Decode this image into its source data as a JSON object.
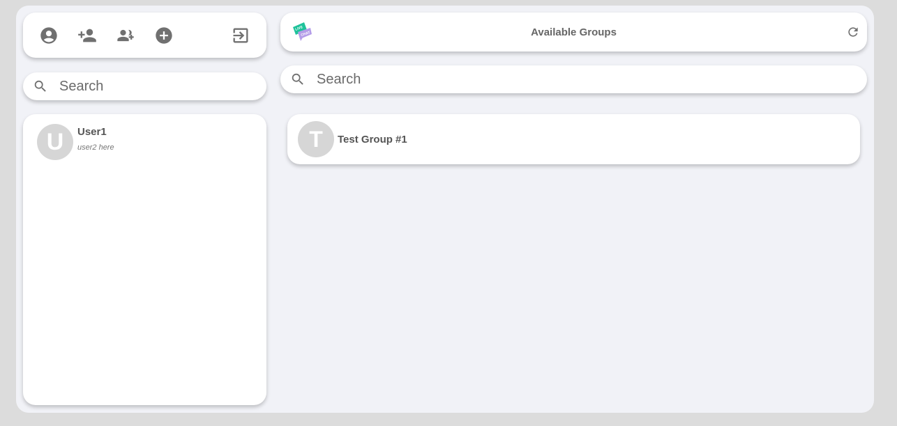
{
  "toolbar": {
    "icons": [
      "account-circle-icon",
      "person-add-icon",
      "group-add-icon",
      "add-circle-icon",
      "dark-mode-moon-icon",
      "logout-icon"
    ]
  },
  "left_search": {
    "placeholder": "Search"
  },
  "users": [
    {
      "initial": "U",
      "name": "User1",
      "status": "user2 here"
    }
  ],
  "header": {
    "title": "Available Groups",
    "logo_text_1": "LIVE",
    "logo_text_2": "CHAT"
  },
  "right_search": {
    "placeholder": "Search"
  },
  "groups": [
    {
      "initial": "T",
      "name": "Test Group #1"
    }
  ],
  "colors": {
    "background": "#dcdcdc",
    "panel": "#f1f2f7",
    "icon": "#707070",
    "avatar": "#d6d6d6",
    "logo_green": "#1fc29a",
    "logo_purple": "#b49de8"
  }
}
